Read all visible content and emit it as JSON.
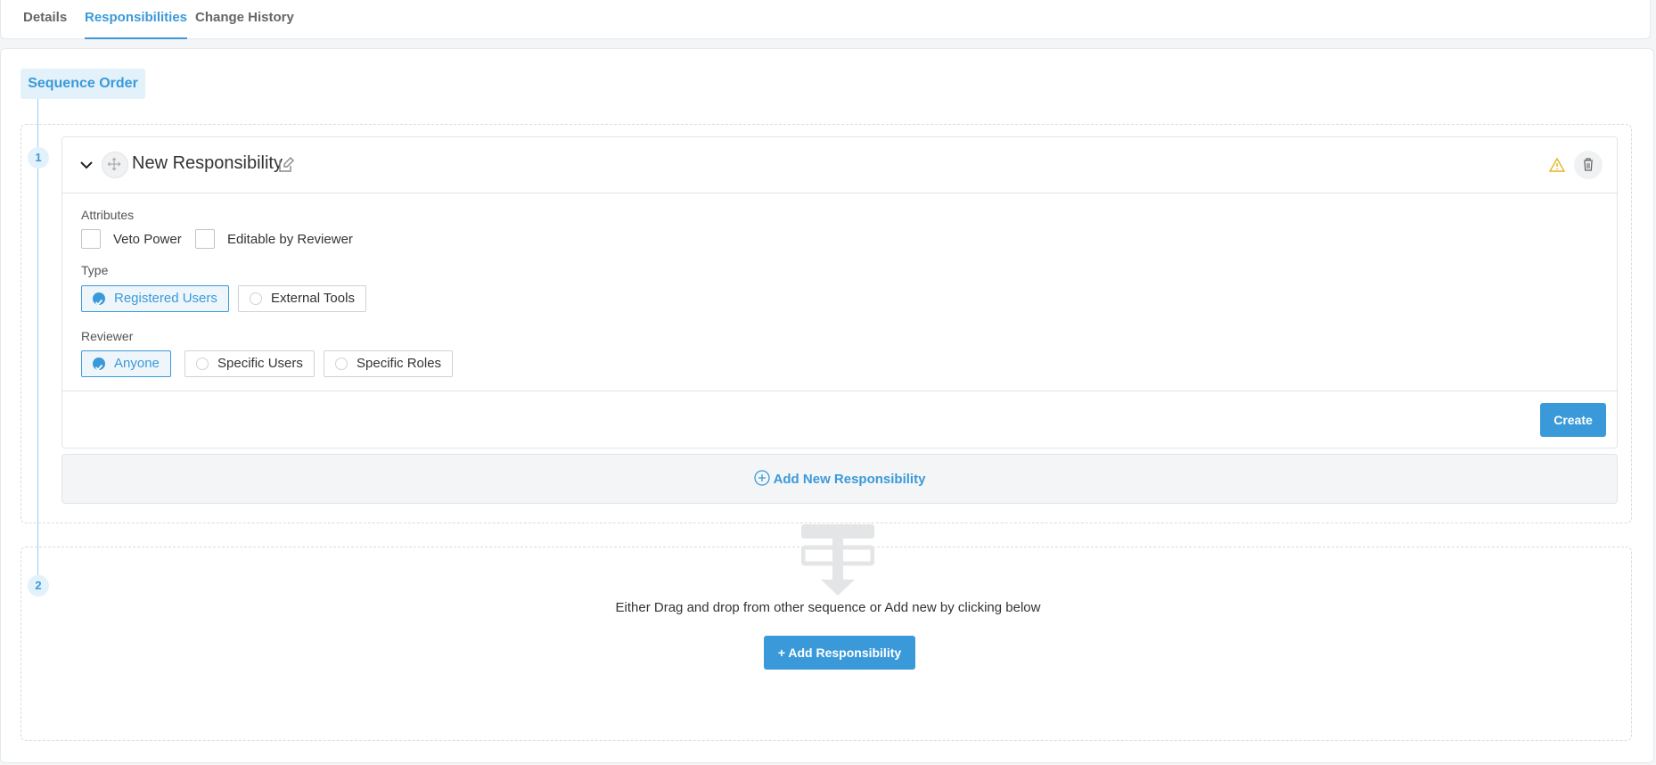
{
  "tabs": [
    {
      "label": "Details",
      "active": false
    },
    {
      "label": "Responsibilities",
      "active": true
    },
    {
      "label": "Change History",
      "active": false
    }
  ],
  "sequence": {
    "label": "Sequence Order",
    "steps": [
      "1",
      "2"
    ]
  },
  "responsibility": {
    "title": "New Responsibility",
    "attributes_label": "Attributes",
    "attributes": [
      {
        "label": "Veto Power",
        "checked": false
      },
      {
        "label": "Editable by Reviewer",
        "checked": false
      }
    ],
    "type_label": "Type",
    "type_options": [
      {
        "label": "Registered Users",
        "selected": true
      },
      {
        "label": "External Tools",
        "selected": false
      }
    ],
    "reviewer_label": "Reviewer",
    "reviewer_options": [
      {
        "label": "Anyone",
        "selected": true
      },
      {
        "label": "Specific Users",
        "selected": false
      },
      {
        "label": "Specific Roles",
        "selected": false
      }
    ],
    "create_label": "Create"
  },
  "add_new": {
    "label": "Add New Responsibility"
  },
  "empty_state": {
    "message": "Either Drag and drop from other sequence or Add new by clicking below",
    "button_label": "+ Add Responsibility"
  },
  "colors": {
    "accent": "#3a9ad9",
    "warning": "#e6b422"
  }
}
